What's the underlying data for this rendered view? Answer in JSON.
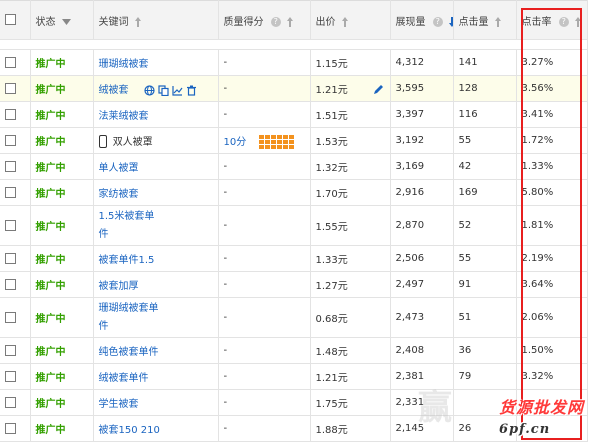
{
  "columns": {
    "status": "状态",
    "keyword": "关键词",
    "quality": "质量得分",
    "bid": "出价",
    "impressions": "展现量",
    "clicks": "点击量",
    "ctr": "点击率"
  },
  "rows": [
    {
      "status": "推广中",
      "keyword": "珊瑚绒被套",
      "quality": "-",
      "bid": "1.15元",
      "impressions": "4,312",
      "clicks": "141",
      "ctr": "3.27%"
    },
    {
      "status": "推广中",
      "keyword": "绒被套",
      "quality": "-",
      "bid": "1.21元",
      "impressions": "3,595",
      "clicks": "128",
      "ctr": "3.56%"
    },
    {
      "status": "推广中",
      "keyword": "法莱绒被套",
      "quality": "-",
      "bid": "1.51元",
      "impressions": "3,397",
      "clicks": "116",
      "ctr": "3.41%"
    },
    {
      "status": "推广中",
      "keyword": "双人被罩",
      "quality": "10分",
      "bid": "1.53元",
      "impressions": "3,192",
      "clicks": "55",
      "ctr": "1.72%"
    },
    {
      "status": "推广中",
      "keyword": "单人被罩",
      "quality": "-",
      "bid": "1.32元",
      "impressions": "3,169",
      "clicks": "42",
      "ctr": "1.33%"
    },
    {
      "status": "推广中",
      "keyword": "家纺被套",
      "quality": "-",
      "bid": "1.70元",
      "impressions": "2,916",
      "clicks": "169",
      "ctr": "5.80%"
    },
    {
      "status": "推广中",
      "keyword": "1.5米被套单件",
      "quality": "-",
      "bid": "1.55元",
      "impressions": "2,870",
      "clicks": "52",
      "ctr": "1.81%"
    },
    {
      "status": "推广中",
      "keyword": "被套单件1.5",
      "quality": "-",
      "bid": "1.33元",
      "impressions": "2,506",
      "clicks": "55",
      "ctr": "2.19%"
    },
    {
      "status": "推广中",
      "keyword": "被套加厚",
      "quality": "-",
      "bid": "1.27元",
      "impressions": "2,497",
      "clicks": "91",
      "ctr": "3.64%"
    },
    {
      "status": "推广中",
      "keyword": "珊瑚绒被套单件",
      "quality": "-",
      "bid": "0.68元",
      "impressions": "2,473",
      "clicks": "51",
      "ctr": "2.06%"
    },
    {
      "status": "推广中",
      "keyword": "纯色被套单件",
      "quality": "-",
      "bid": "1.48元",
      "impressions": "2,408",
      "clicks": "36",
      "ctr": "1.50%"
    },
    {
      "status": "推广中",
      "keyword": "绒被套单件",
      "quality": "-",
      "bid": "1.21元",
      "impressions": "2,381",
      "clicks": "79",
      "ctr": "3.32%"
    },
    {
      "status": "推广中",
      "keyword": "学生被套",
      "quality": "-",
      "bid": "1.75元",
      "impressions": "2,331",
      "clicks": "",
      "ctr": ""
    },
    {
      "status": "推广中",
      "keyword": "被套150 210",
      "quality": "-",
      "bid": "1.88元",
      "impressions": "2,145",
      "clicks": "26",
      "ctr": ""
    }
  ],
  "watermark": {
    "main": "货源批发网",
    "site": "6pf.cn",
    "faint": "赢"
  },
  "colors": {
    "status": "#33a000",
    "link": "#1a64c0",
    "highlight_box": "#e81f1f",
    "quality_bar": "#f3921e"
  },
  "icons": {
    "header": [
      "checkbox",
      "dropdown-arrow",
      "sort-arrow",
      "help-icon",
      "sort-desc-arrow"
    ],
    "row_tools": [
      "globe-icon",
      "copy-icon",
      "trend-icon",
      "delete-icon"
    ],
    "edit": "pencil-icon",
    "device": "mobile-icon"
  }
}
